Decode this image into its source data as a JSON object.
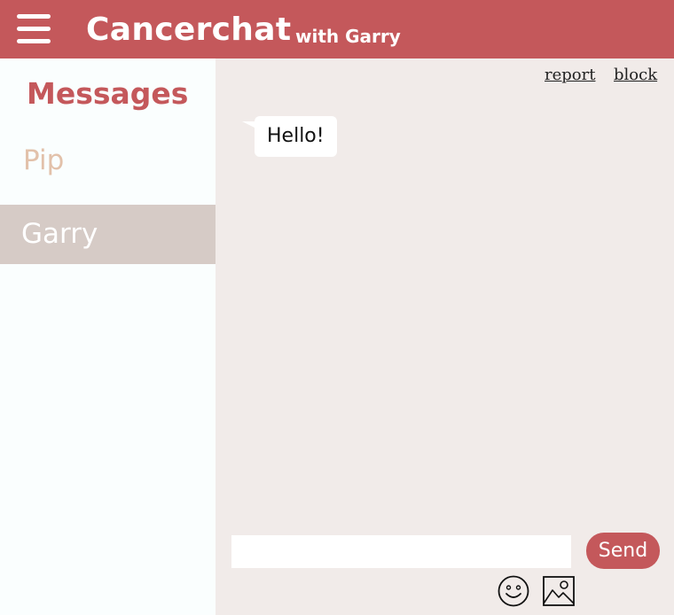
{
  "header": {
    "title": "Cancerchat",
    "subtitle": "with Garry",
    "menu_icon": "hamburger-menu-icon"
  },
  "sidebar": {
    "heading": "Messages",
    "contacts": [
      {
        "name": "Pip",
        "selected": false
      },
      {
        "name": "Garry",
        "selected": true
      }
    ]
  },
  "chat": {
    "links": {
      "report": "report",
      "block": "block"
    },
    "messages": [
      {
        "text": "Hello!",
        "from": "Garry"
      }
    ],
    "input": {
      "value": "",
      "placeholder": ""
    },
    "send_label": "Send",
    "icons": {
      "emoji": "smiley-face-icon",
      "image": "image-icon"
    }
  },
  "colors": {
    "accent": "#c4585b",
    "selected_contact_bg": "#d6cbc6",
    "chat_bg": "#f1ebe9",
    "pip_text": "#e2c1aa"
  }
}
